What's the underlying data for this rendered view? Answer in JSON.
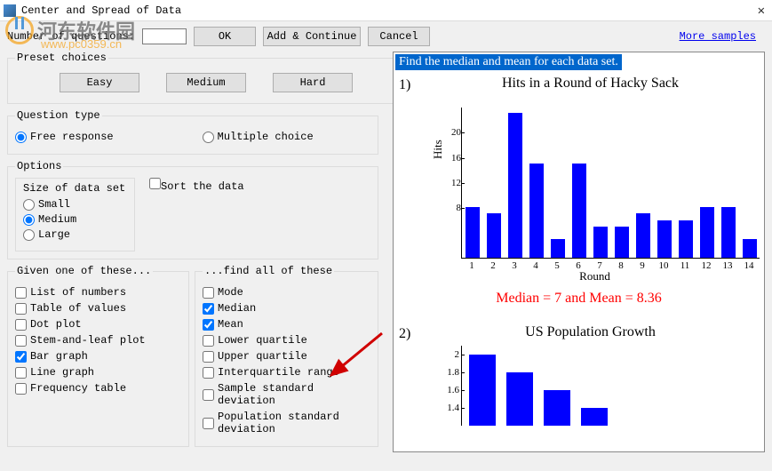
{
  "window": {
    "title": "Center and Spread of Data"
  },
  "watermark": {
    "text": "河东软件园",
    "url": "www.pc0359.cn"
  },
  "toolbar": {
    "numq_label": "Number of questions:",
    "numq_value": "",
    "ok": "OK",
    "addcont": "Add & Continue",
    "cancel": "Cancel",
    "more": "More samples"
  },
  "preset": {
    "legend": "Preset choices",
    "easy": "Easy",
    "medium": "Medium",
    "hard": "Hard"
  },
  "qtype": {
    "legend": "Question type",
    "free": "Free response",
    "mc": "Multiple choice",
    "selected": "free"
  },
  "options": {
    "legend": "Options",
    "size_legend": "Size of data set",
    "small": "Small",
    "medium": "Medium",
    "large": "Large",
    "size_selected": "medium",
    "sort": "Sort the data",
    "sort_checked": false
  },
  "given": {
    "legend": "Given one of these...",
    "items": [
      {
        "label": "List of numbers",
        "checked": false
      },
      {
        "label": "Table of values",
        "checked": false
      },
      {
        "label": "Dot plot",
        "checked": false
      },
      {
        "label": "Stem-and-leaf plot",
        "checked": false
      },
      {
        "label": "Bar graph",
        "checked": true
      },
      {
        "label": "Line graph",
        "checked": false
      },
      {
        "label": "Frequency table",
        "checked": false
      }
    ]
  },
  "find": {
    "legend": "...find all of these",
    "items": [
      {
        "label": "Mode",
        "checked": false
      },
      {
        "label": "Median",
        "checked": true
      },
      {
        "label": "Mean",
        "checked": true
      },
      {
        "label": "Lower quartile",
        "checked": false
      },
      {
        "label": "Upper quartile",
        "checked": false
      },
      {
        "label": "Interquartile range",
        "checked": false
      },
      {
        "label": "Sample standard deviation",
        "checked": false
      },
      {
        "label": "Population standard deviation",
        "checked": false
      }
    ]
  },
  "preview": {
    "prompt": "Find the median and mean for each data set.",
    "q1": {
      "num": "1)",
      "title": "Hits in a Round of Hacky Sack",
      "xlabel": "Round",
      "ylabel": "Hits",
      "answer": "Median = 7 and Mean = 8.36"
    },
    "q2": {
      "num": "2)",
      "title": "US Population Growth"
    }
  },
  "chart_data": [
    {
      "type": "bar",
      "title": "Hits in a Round of Hacky Sack",
      "xlabel": "Round",
      "ylabel": "Hits",
      "categories": [
        "1",
        "2",
        "3",
        "4",
        "5",
        "6",
        "7",
        "8",
        "9",
        "10",
        "11",
        "12",
        "13",
        "14"
      ],
      "values": [
        8,
        7,
        23,
        15,
        3,
        15,
        5,
        5,
        7,
        6,
        6,
        8,
        8,
        3
      ],
      "ylim": [
        0,
        24
      ],
      "yticks": [
        8,
        12,
        16,
        20
      ]
    },
    {
      "type": "bar",
      "title": "US Population Growth",
      "values": [
        2.0,
        1.8,
        1.6,
        1.4
      ],
      "yticks": [
        1.4,
        1.6,
        1.8,
        2.0
      ],
      "ylim": [
        1.2,
        2.1
      ]
    }
  ]
}
